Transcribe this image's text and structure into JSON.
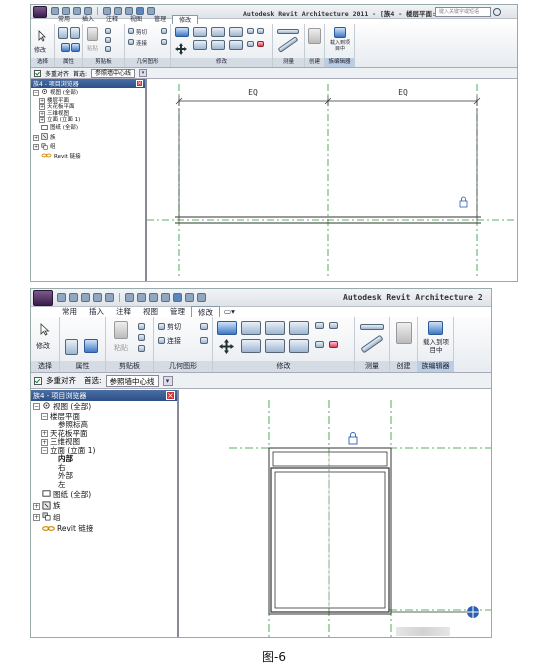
{
  "s1": {
    "title": "Autodesk Revit Architecture 2011 - [族4 - 楼层平面:...",
    "search_placeholder": "键入关键字或短语",
    "tabs": [
      "常用",
      "插入",
      "注释",
      "视图",
      "管理",
      "修改"
    ],
    "active_tab": "修改",
    "panels": [
      "选择",
      "属性",
      "剪贴板",
      "几何图形",
      "修改",
      "测量",
      "创建",
      "族编辑器"
    ],
    "buttons": {
      "modify": "修改",
      "paste": "粘贴",
      "cut": "剪切",
      "join": "连接",
      "load": "载入到项目中"
    },
    "options": {
      "multi_align": "多重对齐",
      "prefer_label": "首选:",
      "prefer_value": "参照墙中心线"
    },
    "browser_title": "族4 - 项目浏览器",
    "tree": [
      {
        "exp": "−",
        "icon": "views-icon",
        "label": "视图 (全部)",
        "depth": 0
      },
      {
        "exp": "+",
        "icon": "",
        "label": "楼层平面",
        "depth": 1
      },
      {
        "exp": "+",
        "icon": "",
        "label": "天花板平面",
        "depth": 1
      },
      {
        "exp": "+",
        "icon": "",
        "label": "三维视图",
        "depth": 1
      },
      {
        "exp": "+",
        "icon": "",
        "label": "立面 (立面 1)",
        "depth": 1
      },
      {
        "exp": "",
        "icon": "sheet-icon",
        "label": "图纸 (全部)",
        "depth": 0
      },
      {
        "exp": "+",
        "icon": "family-icon",
        "label": "族",
        "depth": 0
      },
      {
        "exp": "+",
        "icon": "group-icon",
        "label": "组",
        "depth": 0
      },
      {
        "exp": "",
        "icon": "link-icon",
        "label": "Revit 链接",
        "depth": 0
      }
    ],
    "dims": [
      "EQ",
      "EQ"
    ]
  },
  "s2": {
    "title": "Autodesk Revit Architecture 2",
    "tabs": [
      "常用",
      "插入",
      "注释",
      "视图",
      "管理",
      "修改"
    ],
    "active_tab": "修改",
    "panels": [
      "选择",
      "属性",
      "剪贴板",
      "几何图形",
      "修改",
      "测量",
      "创建",
      "族编辑器"
    ],
    "buttons": {
      "modify": "修改",
      "paste": "粘贴",
      "cut": "剪切",
      "join": "连接",
      "load": "载入到项目中"
    },
    "options": {
      "multi_align": "多重对齐",
      "prefer_label": "首选:",
      "prefer_value": "参照墙中心线"
    },
    "browser_title": "族4 - 项目浏览器",
    "tree": [
      {
        "exp": "−",
        "icon": "views-icon",
        "label": "视图 (全部)",
        "depth": 0,
        "bold": false
      },
      {
        "exp": "−",
        "icon": "",
        "label": "楼层平面",
        "depth": 1,
        "bold": false
      },
      {
        "exp": "",
        "icon": "",
        "label": "参照标高",
        "depth": 2,
        "bold": false
      },
      {
        "exp": "+",
        "icon": "",
        "label": "天花板平面",
        "depth": 1,
        "bold": false
      },
      {
        "exp": "+",
        "icon": "",
        "label": "三维视图",
        "depth": 1,
        "bold": false
      },
      {
        "exp": "−",
        "icon": "",
        "label": "立面 (立面 1)",
        "depth": 1,
        "bold": false
      },
      {
        "exp": "",
        "icon": "",
        "label": "内部",
        "depth": 2,
        "bold": true
      },
      {
        "exp": "",
        "icon": "",
        "label": "右",
        "depth": 2,
        "bold": false
      },
      {
        "exp": "",
        "icon": "",
        "label": "外部",
        "depth": 2,
        "bold": false
      },
      {
        "exp": "",
        "icon": "",
        "label": "左",
        "depth": 2,
        "bold": false
      },
      {
        "exp": "",
        "icon": "sheet-icon",
        "label": "图纸 (全部)",
        "depth": 0,
        "bold": false
      },
      {
        "exp": "+",
        "icon": "family-icon",
        "label": "族",
        "depth": 0,
        "bold": false
      },
      {
        "exp": "+",
        "icon": "group-icon",
        "label": "组",
        "depth": 0,
        "bold": false
      },
      {
        "exp": "",
        "icon": "link-icon",
        "label": "Revit 链接",
        "depth": 0,
        "bold": false
      }
    ]
  },
  "caption": "图-6",
  "colors": {
    "ref_line": "#2a9a2a",
    "active_tab_border": "#8899aa",
    "browser_header": "#2b4f86"
  }
}
